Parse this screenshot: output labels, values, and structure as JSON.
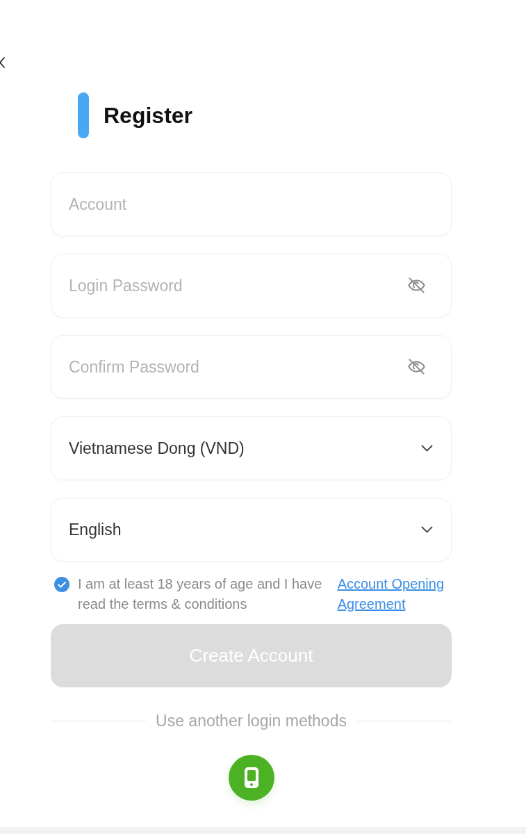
{
  "title": "Register",
  "fields": [
    {
      "kind": "text",
      "placeholder": "Account"
    },
    {
      "kind": "password",
      "placeholder": "Login Password"
    },
    {
      "kind": "password",
      "placeholder": "Confirm Password"
    },
    {
      "kind": "select",
      "value": "Vietnamese Dong (VND)"
    },
    {
      "kind": "select",
      "value": "English"
    }
  ],
  "agreement": {
    "checked": true,
    "text": "I am at least 18 years of age and I have read the terms & conditions",
    "link": "Account Opening Agreement"
  },
  "submit": {
    "label": "Create Account",
    "disabled": true
  },
  "alt_login": {
    "label": "Use another login methods"
  }
}
